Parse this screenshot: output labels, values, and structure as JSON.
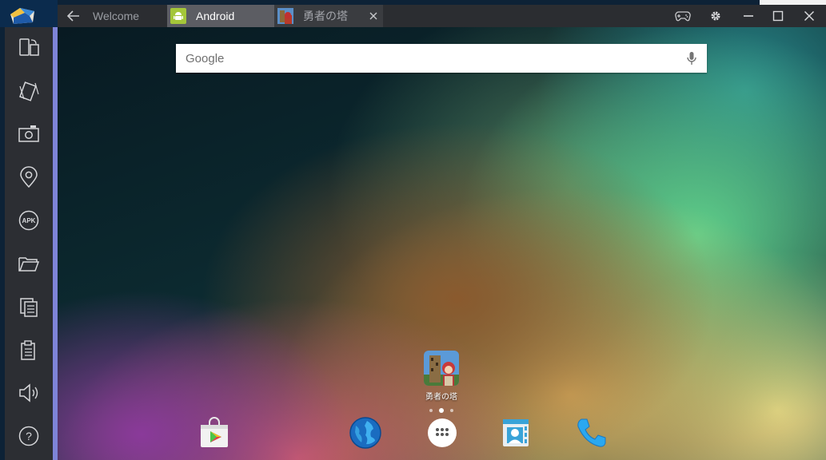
{
  "window": {
    "back_icon": "arrow-left-icon",
    "tabs": [
      {
        "label": "Welcome",
        "icon": null
      },
      {
        "label": "Android",
        "icon": "android-icon",
        "active": true
      },
      {
        "label": "勇者の塔",
        "icon": "game-thumbnail-icon"
      }
    ],
    "controls": [
      "gamepad-icon",
      "gear-icon",
      "minimize-icon",
      "maximize-icon",
      "close-icon"
    ]
  },
  "sidebar": {
    "items": [
      "rotate-screen-icon",
      "shake-icon",
      "camera-icon",
      "location-icon",
      "apk-icon",
      "folder-icon",
      "copy-icon",
      "paste-icon",
      "volume-icon",
      "help-icon"
    ],
    "apk_text": "APK",
    "help_text": "?"
  },
  "android": {
    "search": {
      "placeholder": "Google",
      "mic_icon": "microphone-icon"
    },
    "home_app": {
      "label": "勇者の塔",
      "icon": "game-icon"
    },
    "page_dots": 3,
    "active_dot": 1,
    "dock": [
      "play-store-icon",
      "browser-globe-icon",
      "app-drawer-icon",
      "contacts-icon",
      "phone-icon"
    ]
  },
  "colors": {
    "sidebar_bg": "#2c2e33",
    "sidebar_accent": "#7e84d8",
    "tabbar_bg": "#2b2d31",
    "active_tab_bg": "#5c5d63",
    "android_green": "#a4c639"
  }
}
